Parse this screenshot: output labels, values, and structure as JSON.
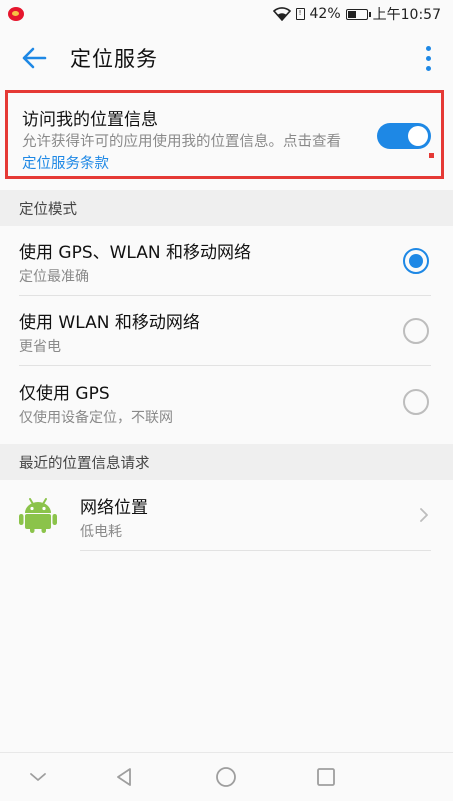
{
  "status_bar": {
    "battery_percent": "42%",
    "time": "上午10:57",
    "icons": [
      "weibo-icon",
      "wifi-icon",
      "sim-icon",
      "battery-icon"
    ]
  },
  "app_bar": {
    "title": "定位服务",
    "icons": [
      "back-arrow-icon",
      "more-vert-icon"
    ],
    "accent_color": "#1e88e5"
  },
  "access": {
    "title": "访问我的位置信息",
    "desc_prefix": "允许获得许可的应用使用我的位置信息。点击查看",
    "link_text": "定位服务条款",
    "toggle_on": true,
    "highlight_color": "#e53935"
  },
  "location_mode": {
    "header": "定位模式",
    "options": [
      {
        "title": "使用 GPS、WLAN 和移动网络",
        "subtitle": "定位最准确",
        "selected": true
      },
      {
        "title": "使用 WLAN 和移动网络",
        "subtitle": "更省电",
        "selected": false
      },
      {
        "title": "仅使用 GPS",
        "subtitle": "仅使用设备定位，不联网",
        "selected": false
      }
    ]
  },
  "recent_requests": {
    "header": "最近的位置信息请求",
    "items": [
      {
        "title": "网络位置",
        "subtitle": "低电耗",
        "icon": "android-icon"
      }
    ]
  },
  "nav_bar": {
    "icons": [
      "nav-hide-icon",
      "nav-back-icon",
      "nav-home-icon",
      "nav-recents-icon"
    ]
  }
}
